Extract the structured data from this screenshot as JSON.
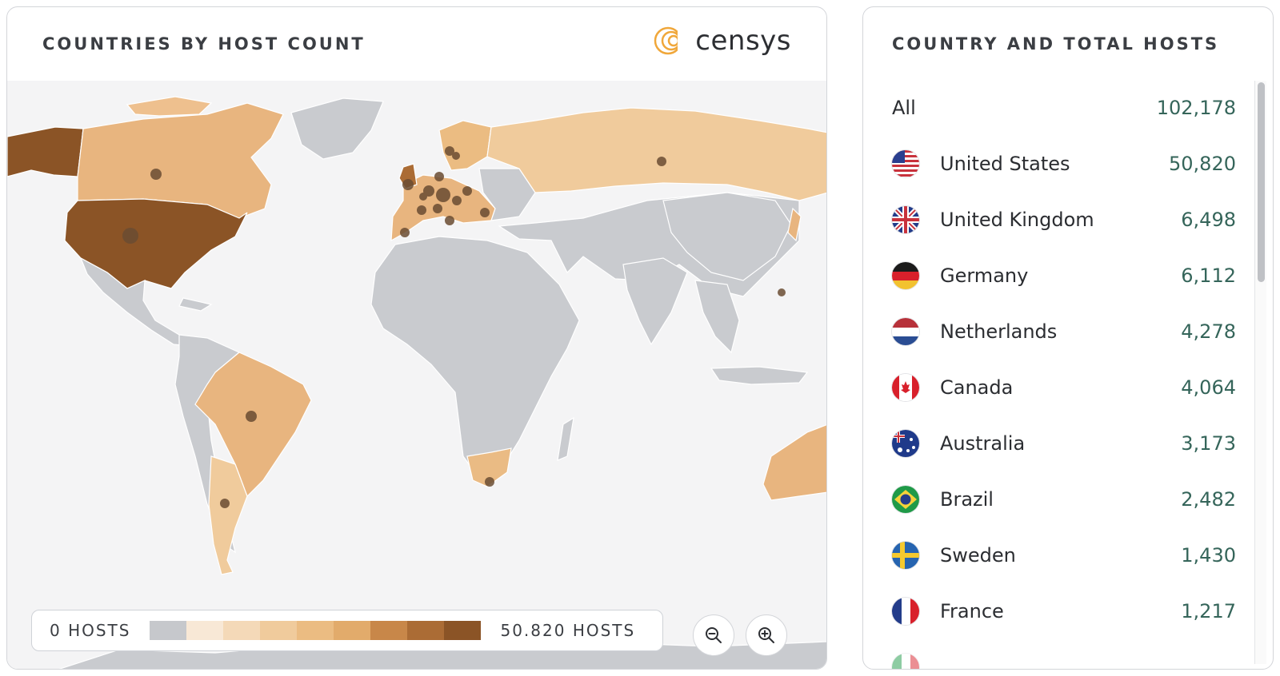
{
  "map_panel": {
    "title": "COUNTRIES BY HOST COUNT",
    "brand": "censys",
    "legend": {
      "min_label": "0 HOSTS",
      "max_label": "50.820 HOSTS",
      "scale_colors": [
        "#c6c8cc",
        "#f8e8d6",
        "#f4d9b8",
        "#f0cb9c",
        "#ebbc82",
        "#e2ab6b",
        "#c88749",
        "#ab6c35",
        "#8b5426"
      ]
    },
    "zoom_out_icon": "zoom-out-icon",
    "zoom_in_icon": "zoom-in-icon",
    "colors": {
      "no_data": "#c9cbcf",
      "ocean": "#f4f4f5",
      "marker": "#6a4c32"
    }
  },
  "list_panel": {
    "title": "COUNTRY AND TOTAL HOSTS",
    "rows": [
      {
        "name": "All",
        "count": "102,178",
        "flag": ""
      },
      {
        "name": "United States",
        "count": "50,820",
        "flag": "us-flag-icon"
      },
      {
        "name": "United Kingdom",
        "count": "6,498",
        "flag": "uk-flag-icon"
      },
      {
        "name": "Germany",
        "count": "6,112",
        "flag": "de-flag-icon"
      },
      {
        "name": "Netherlands",
        "count": "4,278",
        "flag": "nl-flag-icon"
      },
      {
        "name": "Canada",
        "count": "4,064",
        "flag": "ca-flag-icon"
      },
      {
        "name": "Australia",
        "count": "3,173",
        "flag": "au-flag-icon"
      },
      {
        "name": "Brazil",
        "count": "2,482",
        "flag": "br-flag-icon"
      },
      {
        "name": "Sweden",
        "count": "1,430",
        "flag": "se-flag-icon"
      },
      {
        "name": "France",
        "count": "1,217",
        "flag": "fr-flag-icon"
      }
    ]
  }
}
